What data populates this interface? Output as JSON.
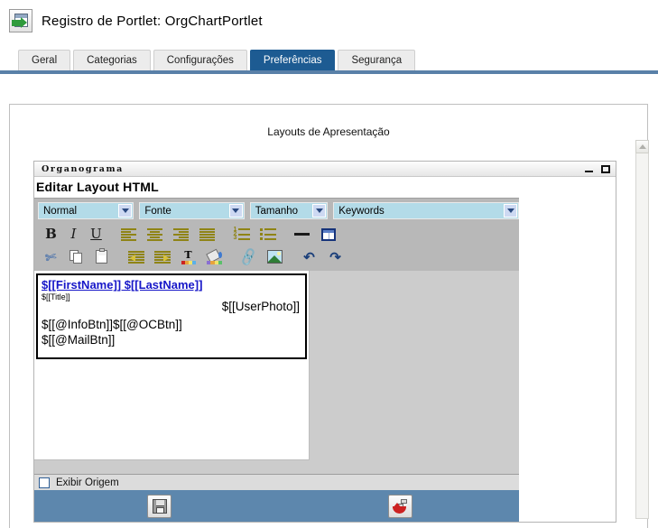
{
  "header": {
    "icon": "portlet-register-icon",
    "title": "Registro de Portlet: OrgChartPortlet"
  },
  "tabs": [
    {
      "label": "Geral",
      "active": false
    },
    {
      "label": "Categorias",
      "active": false
    },
    {
      "label": "Configurações",
      "active": false
    },
    {
      "label": "Preferências",
      "active": true
    },
    {
      "label": "Segurança",
      "active": false
    }
  ],
  "main": {
    "section_title": "Layouts de Apresentação"
  },
  "editor": {
    "window_title": "Organograma",
    "window_controls": {
      "minimize": "minimize-icon",
      "maximize": "maximize-icon"
    },
    "heading": "Editar Layout HTML",
    "selects": [
      {
        "name": "paragraph-style",
        "value": "Normal"
      },
      {
        "name": "font-family",
        "value": "Fonte"
      },
      {
        "name": "font-size",
        "value": "Tamanho"
      },
      {
        "name": "keywords",
        "value": "Keywords"
      }
    ],
    "toolbar_row1": [
      {
        "name": "bold-icon",
        "glyph": "B"
      },
      {
        "name": "italic-icon",
        "glyph": "I"
      },
      {
        "name": "underline-icon",
        "glyph": "U"
      },
      {
        "name": "align-left-icon"
      },
      {
        "name": "align-center-icon"
      },
      {
        "name": "align-right-icon"
      },
      {
        "name": "align-justify-icon"
      },
      {
        "name": "numbered-list-icon"
      },
      {
        "name": "bulleted-list-icon"
      },
      {
        "name": "horizontal-rule-icon"
      },
      {
        "name": "insert-table-icon"
      }
    ],
    "toolbar_row2": [
      {
        "name": "cut-icon"
      },
      {
        "name": "copy-icon"
      },
      {
        "name": "paste-icon"
      },
      {
        "name": "outdent-icon"
      },
      {
        "name": "indent-icon"
      },
      {
        "name": "text-color-icon"
      },
      {
        "name": "background-color-icon"
      },
      {
        "name": "insert-link-icon"
      },
      {
        "name": "insert-image-icon"
      },
      {
        "name": "undo-icon",
        "glyph": "↶"
      },
      {
        "name": "redo-icon",
        "glyph": "↷"
      }
    ],
    "content": {
      "name_tokens": "$[[FirstName]] $[[LastName]]",
      "title_token": "$[[Title]]",
      "button_tokens_line1": "$[[@InfoBtn]]$[[@OCBtn]]",
      "button_tokens_line2": "$[[@MailBtn]]",
      "photo_token": "$[[UserPhoto]]"
    },
    "source_checkbox": {
      "label": "Exibir Origem",
      "checked": false
    },
    "actions": [
      {
        "name": "save-button",
        "icon": "floppy-disk-icon"
      },
      {
        "name": "revert-button",
        "icon": "restore-arrow-icon"
      }
    ]
  },
  "scrollbar": {
    "up_arrow": "scroll-up-icon"
  },
  "colors": {
    "tab_active": "#1d5b92",
    "tab_bar": "#5980a8",
    "action_bar": "#5d87ad",
    "token_link": "#1616c8",
    "toolbar_bg": "#b8b8b8",
    "select_bg": "#b3dbe8"
  }
}
